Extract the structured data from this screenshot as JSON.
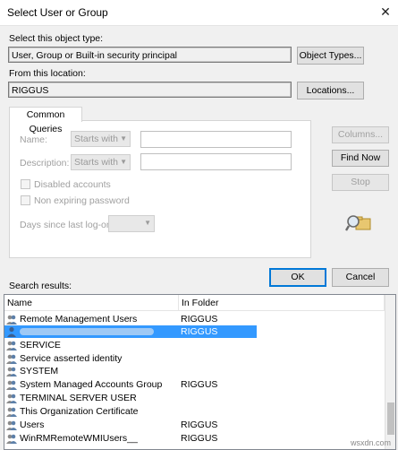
{
  "window": {
    "title": "Select User or Group",
    "close_glyph": "✕"
  },
  "object_type": {
    "label": "Select this object type:",
    "value": "User, Group or Built-in security principal",
    "button": "Object Types..."
  },
  "location": {
    "label": "From this location:",
    "value": "RIGGUS",
    "button": "Locations..."
  },
  "common_queries": {
    "tab_label": "Common Queries",
    "name_label": "Name:",
    "name_mode": "Starts with",
    "description_label": "Description:",
    "description_mode": "Starts with",
    "disabled_accounts": "Disabled accounts",
    "non_expiring_password": "Non expiring password",
    "days_label": "Days since last log-on:",
    "columns_button": "Columns...",
    "find_now_button": "Find Now",
    "stop_button": "Stop",
    "search_icon": "search-icon"
  },
  "actions": {
    "ok": "OK",
    "cancel": "Cancel"
  },
  "results": {
    "label": "Search results:",
    "columns": [
      "Name",
      "In Folder"
    ],
    "rows": [
      {
        "name": "Remote Management Users",
        "folder": "RIGGUS",
        "icon": "group-icon"
      },
      {
        "name": "",
        "folder": "RIGGUS",
        "icon": "user-icon",
        "selected": true
      },
      {
        "name": "SERVICE",
        "folder": "",
        "icon": "group-icon"
      },
      {
        "name": "Service asserted identity",
        "folder": "",
        "icon": "group-icon"
      },
      {
        "name": "SYSTEM",
        "folder": "",
        "icon": "group-icon"
      },
      {
        "name": "System Managed Accounts Group",
        "folder": "RIGGUS",
        "icon": "group-icon"
      },
      {
        "name": "TERMINAL SERVER USER",
        "folder": "",
        "icon": "group-icon"
      },
      {
        "name": "This Organization Certificate",
        "folder": "",
        "icon": "group-icon"
      },
      {
        "name": "Users",
        "folder": "RIGGUS",
        "icon": "group-icon"
      },
      {
        "name": "WinRMRemoteWMIUsers__",
        "folder": "RIGGUS",
        "icon": "group-icon"
      }
    ]
  },
  "watermark": "wsxdn.com"
}
